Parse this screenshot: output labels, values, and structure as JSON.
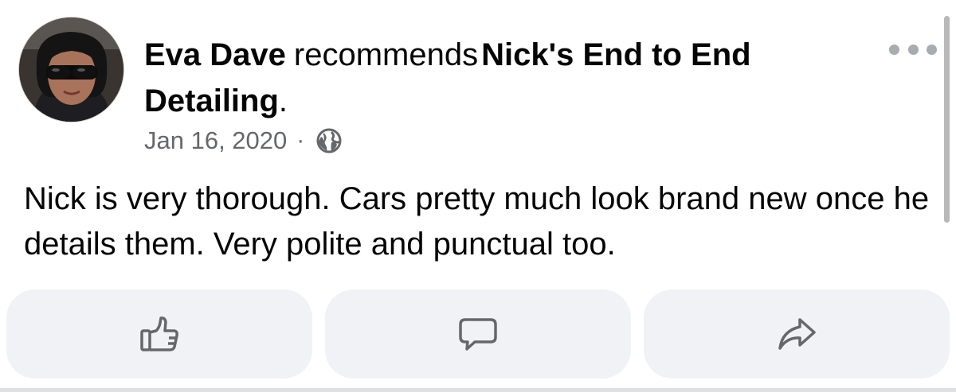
{
  "post": {
    "author": "Eva Dave",
    "verb": "recommends",
    "page_name": "Nick's End to End Detailing",
    "punctuation": ".",
    "date": "Jan 16, 2020",
    "separator": "·",
    "audience_icon": "globe-icon",
    "more_icon": "more-options-icon",
    "text": "Nick is very thorough. Cars pretty much look brand new once he details them. Very polite and punctual too."
  },
  "actions": [
    {
      "name": "like",
      "icon": "thumbs-up-icon"
    },
    {
      "name": "comment",
      "icon": "comment-icon"
    },
    {
      "name": "share",
      "icon": "share-icon"
    }
  ],
  "colors": {
    "text_primary": "#050505",
    "text_secondary": "#65676b",
    "button_bg": "#f0f2f5",
    "icon": "#65676b"
  }
}
